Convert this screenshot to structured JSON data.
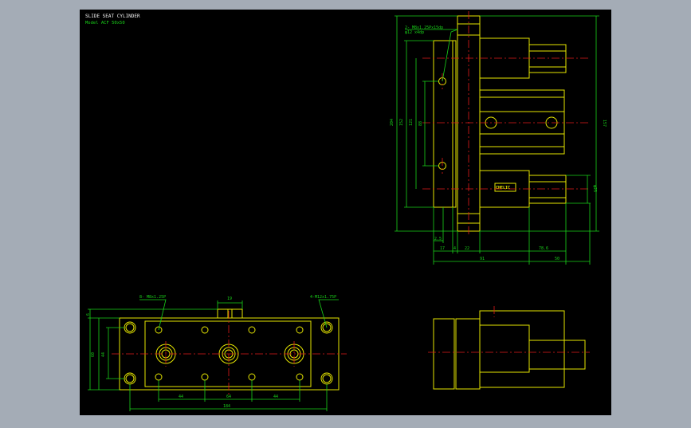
{
  "title": "SLIDE SEAT CYLINDER",
  "model": "Model  ACF 50x50",
  "callouts": {
    "side_thread": "2- M8x1.25Px15dp",
    "side_spot": "φ12 x4dp",
    "bottom_left_thread": "8- M8x1.25P",
    "bottom_right_thread": "4-M12x1.75P"
  },
  "side_view": {
    "height_dims": [
      "204",
      "152",
      "121",
      "88"
    ],
    "total_height": "157",
    "rod_dia": "φ25",
    "brand_label": "CHELIC",
    "bottom_dims": [
      "17",
      "4",
      "22",
      "91",
      "78.6",
      "50"
    ],
    "small_dim": "2.5"
  },
  "front_view": {
    "top_dim": "19",
    "left_dims": [
      "6",
      "60",
      "44"
    ],
    "bottom_dims": [
      "44",
      "64",
      "44"
    ],
    "overall_width": "184"
  },
  "colors": {
    "background": "#000000",
    "frame": "#a4acb6",
    "outline": "#e6e600",
    "dimension": "#19d219",
    "centerline": "#e01b1b",
    "text": "#f2f2f2"
  }
}
